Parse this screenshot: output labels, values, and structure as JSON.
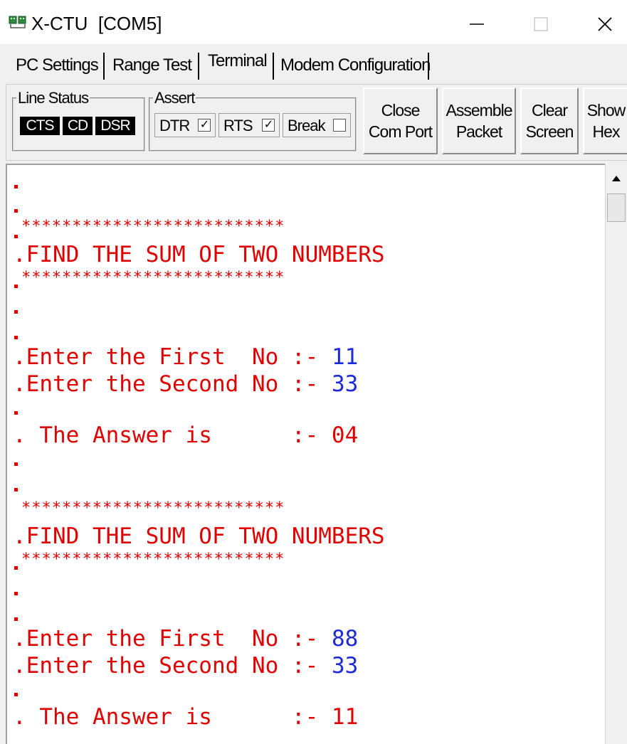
{
  "window": {
    "title": "X-CTU  [COM5]",
    "minimize_icon": "minimize-icon",
    "maximize_icon": "maximize-icon",
    "close_icon": "close-icon"
  },
  "tabs": [
    {
      "label": "PC Settings",
      "active": false
    },
    {
      "label": "Range Test",
      "active": false
    },
    {
      "label": "Terminal",
      "active": true
    },
    {
      "label": "Modem Configuration",
      "active": false
    }
  ],
  "toolbar": {
    "line_status": {
      "legend": "Line Status",
      "items": [
        "CTS",
        "CD",
        "DSR"
      ]
    },
    "assert": {
      "legend": "Assert",
      "items": [
        {
          "label": "DTR",
          "checked": true
        },
        {
          "label": "RTS",
          "checked": true
        },
        {
          "label": "Break",
          "checked": false
        }
      ]
    },
    "buttons": [
      {
        "line1": "Close",
        "line2": "Com Port"
      },
      {
        "line1": "Assemble",
        "line2": "Packet"
      },
      {
        "line1": "Clear",
        "line2": "Screen"
      },
      {
        "line1": "Show",
        "line2": "Hex"
      }
    ]
  },
  "terminal": {
    "text_color": "#e00000",
    "input_color": "#1c2ad8",
    "stars": "**************************",
    "heading": ".FIND THE SUM OF TWO NUMBERS",
    "blocks": [
      {
        "first_prompt": ".Enter the First  No :- ",
        "first_value": "11",
        "second_prompt": ".Enter the Second No :- ",
        "second_value": "33",
        "answer": ". The Answer is      :- 04"
      },
      {
        "first_prompt": ".Enter the First  No :- ",
        "first_value": "88",
        "second_prompt": ".Enter the Second No :- ",
        "second_value": "33",
        "answer": ". The Answer is      :- 11"
      }
    ]
  },
  "scrollbar": {
    "up_icon": "scroll-up-arrow-icon"
  }
}
